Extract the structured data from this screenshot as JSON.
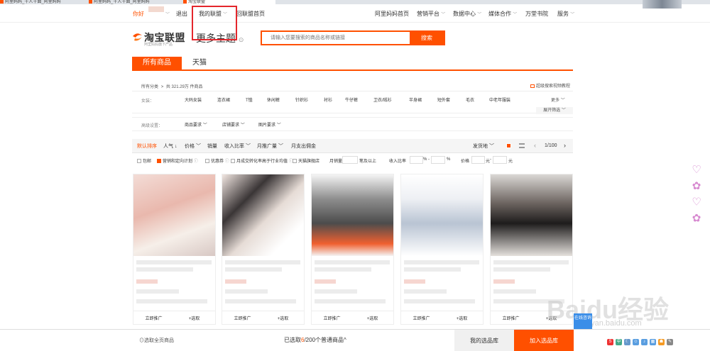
{
  "browser": {
    "tabs": [
      {
        "label": "阿里妈妈_千人千面_阿里妈妈"
      },
      {
        "label": "阿里妈妈_千人千面_阿里妈妈"
      },
      {
        "label": "淘宝联盟"
      }
    ]
  },
  "topnav": {
    "greeting": "你好",
    "logout": "退出",
    "my_union": "我的联盟",
    "back_home": "回联盟首页",
    "right_links": [
      "阿里妈妈首页",
      "营销平台",
      "数据中心",
      "媒体合作",
      "万堂书院",
      "服务"
    ]
  },
  "header": {
    "logo_text": "淘宝联盟",
    "logo_sub": "阿里妈妈旗下产品",
    "more_theme": "更多主题",
    "search_placeholder": "请输入您要搜索的商品名称或链接",
    "search_button": "搜索"
  },
  "category_tabs": [
    "所有商品",
    "天猫"
  ],
  "breadcrumb": {
    "prefix": "所有分类",
    "sep": ">",
    "count_text": "共 321.29万 件商品"
  },
  "advanced_search_link": "超级搜索视频教程",
  "filter": {
    "label": "女装：",
    "items": [
      "大码女装",
      "连衣裙",
      "T恤",
      "休闲裤",
      "针织衫",
      "衬衫",
      "牛仔裤",
      "卫衣/绒衫",
      "半身裙",
      "短外套",
      "毛衣",
      "中老年服装"
    ],
    "more": "更多",
    "expand": "展开筛选"
  },
  "requirements": {
    "label": "高级设置：",
    "items": [
      "商品要求",
      "店铺要求",
      "图片要求"
    ]
  },
  "sortbar": {
    "items": [
      "默认排序",
      "人气",
      "价格",
      "销量",
      "收入比率",
      "月推广量",
      "月支出佣金"
    ],
    "ship_from": "发货地",
    "page": "1/100"
  },
  "options": {
    "items": [
      "包邮",
      "营销和定向计划",
      "优惠券",
      "月成交转化率高于行业均值",
      "天猫旗舰店"
    ],
    "checked": [
      false,
      true,
      false,
      false,
      false
    ],
    "monthly_sales_label": "月销量",
    "monthly_sales_suffix": "笔及以上",
    "income_label": "收入比率",
    "percent": "%",
    "dash": "-",
    "price_label": "价格",
    "yuan": "元"
  },
  "products": [
    {
      "promote": "立即推广",
      "select": "选取",
      "swatch": "#f0d3c8"
    },
    {
      "promote": "立即推广",
      "select": "选取",
      "swatch": "#e8ddd8"
    },
    {
      "promote": "立即推广",
      "select": "选取",
      "swatch": "#c9c9c9"
    },
    {
      "promote": "立即推广",
      "select": "选取",
      "swatch": "#e9eaf0"
    },
    {
      "promote": "立即推广",
      "select": "选取",
      "swatch": "#d8d4d0"
    }
  ],
  "bottombar": {
    "select_all": "⊙选取全页商品",
    "selected_prefix": "已选取",
    "selected_count": "6",
    "selected_suffix": "/200个普通商品",
    "my_library": "我的选品库",
    "add_library": "加入选品库"
  },
  "overlay": {
    "online": "在线咨询",
    "watermark": "Baidu经验",
    "watermark_url": "jingyan.baidu.com"
  }
}
